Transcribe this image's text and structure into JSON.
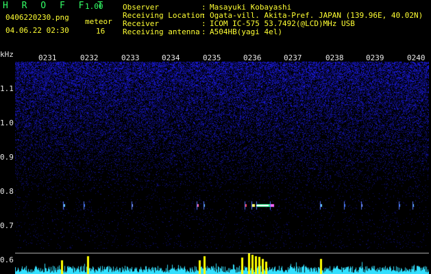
{
  "header": {
    "app_name": "H R O F F T",
    "version": "1.00",
    "filename": "0406220230.png",
    "datetime": "04.06.22 02:30",
    "meteor_label": "meteor",
    "meteor_count": "16"
  },
  "info": [
    {
      "label": "Observer",
      "value": "Masayuki Kobayashi"
    },
    {
      "label": "Receiving Location",
      "value": "Ogata-vill. Akita-Pref. JAPAN (139.96E, 40.02N)"
    },
    {
      "label": "Receiver",
      "value": "ICOM IC-575 53.7492(@LCD)MHz USB"
    },
    {
      "label": "Receiving antenna",
      "value": "A504HB(yagi 4el)"
    }
  ],
  "colon": ":",
  "y_unit": "kHz",
  "time_ticks": [
    "0231",
    "0232",
    "0233",
    "0234",
    "0235",
    "0236",
    "0237",
    "0238",
    "0239",
    "0240"
  ],
  "freq_ticks": [
    "1.1",
    "1.0",
    "0.9",
    "0.8",
    "0.7",
    "0.6"
  ],
  "colors": {
    "title": "#33ff66",
    "text_yellow": "#ffff33",
    "background": "#000000",
    "noise": "#1a1a8c",
    "amp_cyan": "#33e0ff",
    "amp_yellow": "#ffff00"
  }
}
